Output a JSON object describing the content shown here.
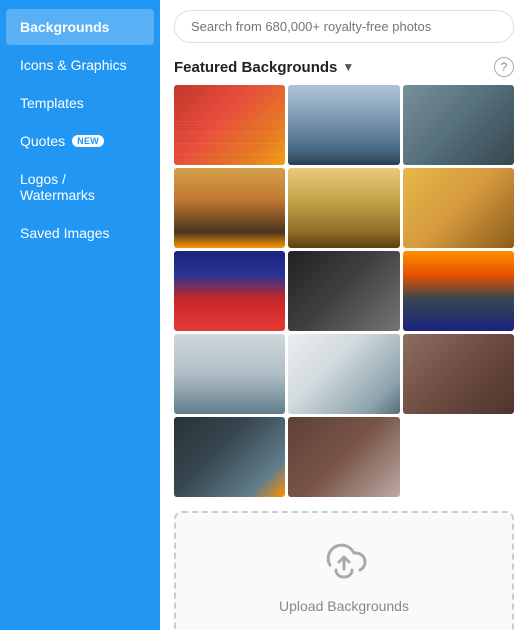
{
  "sidebar": {
    "items": [
      {
        "id": "backgrounds",
        "label": "Backgrounds",
        "active": true,
        "badge": null
      },
      {
        "id": "icons-graphics",
        "label": "Icons & Graphics",
        "active": false,
        "badge": null
      },
      {
        "id": "templates",
        "label": "Templates",
        "active": false,
        "badge": null
      },
      {
        "id": "quotes",
        "label": "Quotes",
        "active": false,
        "badge": "NEW"
      },
      {
        "id": "logos-watermarks",
        "label": "Logos / Watermarks",
        "active": false,
        "badge": null
      },
      {
        "id": "saved-images",
        "label": "Saved Images",
        "active": false,
        "badge": null
      }
    ]
  },
  "search": {
    "placeholder": "Search from 680,000+ royalty-free photos"
  },
  "featured": {
    "title": "Featured Backgrounds",
    "help_label": "?"
  },
  "images": [
    {
      "id": "img-track",
      "css_class": "img-track"
    },
    {
      "id": "img-dock",
      "css_class": "img-dock"
    },
    {
      "id": "img-surf",
      "css_class": "img-surf"
    },
    {
      "id": "img-bench",
      "css_class": "img-bench"
    },
    {
      "id": "img-desert",
      "css_class": "img-desert"
    },
    {
      "id": "img-skate",
      "css_class": "img-skate"
    },
    {
      "id": "img-shoes",
      "css_class": "img-shoes"
    },
    {
      "id": "img-woman",
      "css_class": "img-woman"
    },
    {
      "id": "img-silhouette",
      "css_class": "img-silhouette"
    },
    {
      "id": "img-windmill",
      "css_class": "img-windmill"
    },
    {
      "id": "img-snowy",
      "css_class": "img-snowy"
    },
    {
      "id": "img-coffee",
      "css_class": "img-coffee"
    },
    {
      "id": "img-reading",
      "css_class": "img-reading"
    },
    {
      "id": "img-sitting",
      "css_class": "img-sitting"
    }
  ],
  "upload": {
    "label": "Upload Backgrounds"
  }
}
